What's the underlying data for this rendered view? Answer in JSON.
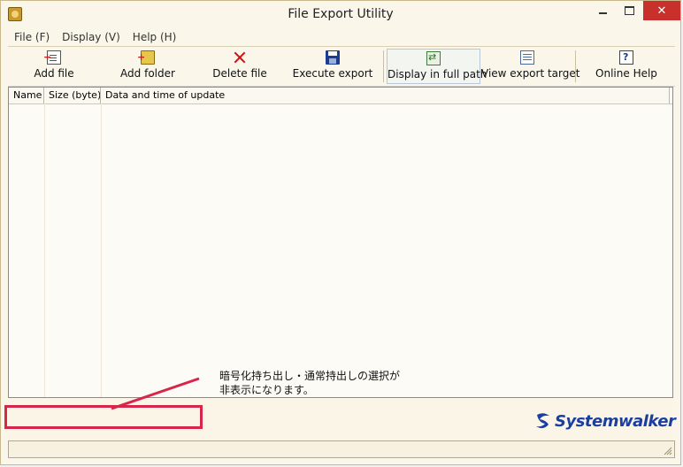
{
  "window": {
    "title": "File Export Utility"
  },
  "menu": {
    "items": [
      "File (F)",
      "Display (V)",
      "Help (H)"
    ]
  },
  "toolbar": {
    "add_file": "Add file",
    "add_folder": "Add folder",
    "delete_file": "Delete file",
    "execute_export": "Execute export",
    "display_full_path": "Display in full path",
    "view_export_target": "View export target",
    "online_help": "Online Help"
  },
  "list": {
    "columns": [
      "Name",
      "Size (byte)",
      "Data and time of update"
    ],
    "rows": []
  },
  "annotation": {
    "line1": "暗号化持ち出し・通常持出しの選択が",
    "line2": "非表示になります。",
    "color": "#d8254a"
  },
  "brand": {
    "name": "Systemwalker",
    "color": "#1a3fa0"
  }
}
